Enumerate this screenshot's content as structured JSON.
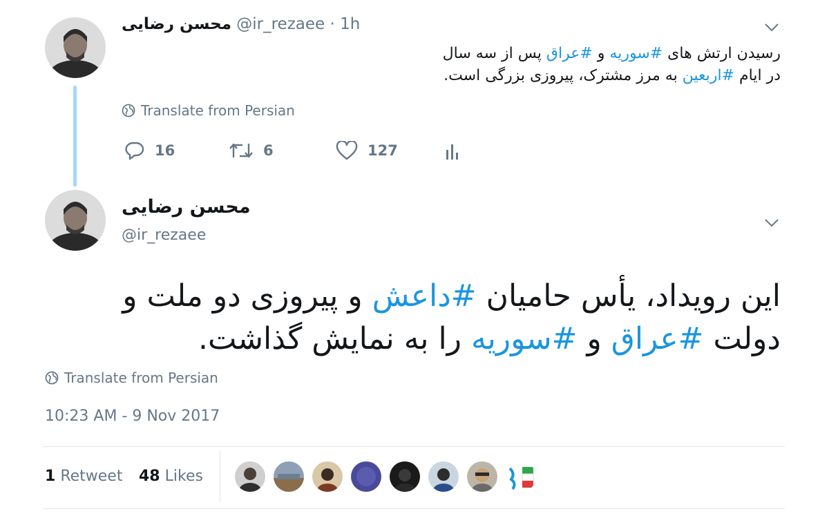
{
  "reply_tweet": {
    "author_name": "محسن رضایی",
    "handle": "@ir_rezaee",
    "separator": "·",
    "time": "1h",
    "text_parts": [
      {
        "t": "رسیدن ارتش های ",
        "tag": false
      },
      {
        "t": "#سوریه",
        "tag": true
      },
      {
        "t": " و ",
        "tag": false
      },
      {
        "t": "#عراق",
        "tag": true
      },
      {
        "t": " پس از سه سال در ایام ",
        "tag": false
      },
      {
        "t": "#اربعین",
        "tag": true
      },
      {
        "t": " به مرز مشترک، پیروزی بزرگی است.",
        "tag": false
      }
    ],
    "translate_label": "Translate from Persian",
    "reply_count": "16",
    "retweet_count": "6",
    "like_count": "127"
  },
  "main_tweet": {
    "author_name": "محسن رضایی",
    "handle": "@ir_rezaee",
    "text_parts": [
      {
        "t": "این رویداد، یأس حامیان ",
        "tag": false
      },
      {
        "t": "#داعش",
        "tag": true
      },
      {
        "t": " و پیروزی دو ملت و دولت ",
        "tag": false
      },
      {
        "t": "#عراق",
        "tag": true
      },
      {
        "t": " و ",
        "tag": false
      },
      {
        "t": "#سوریه",
        "tag": true
      },
      {
        "t": " را به نمایش گذاشت.",
        "tag": false
      }
    ],
    "translate_label": "Translate from Persian",
    "timestamp": "10:23 AM - 9 Nov 2017",
    "retweet_count": "1",
    "retweet_label": "Retweet",
    "like_count": "48",
    "like_label": "Likes"
  },
  "colors": {
    "accent": "#1b95e0",
    "thread_line": "#a5d6f7",
    "muted": "#657786",
    "text": "#14171a",
    "divider": "#e1e8ed"
  },
  "icons": {
    "caret": "chevron-down-icon",
    "globe": "globe-icon",
    "reply": "reply-icon",
    "retweet": "retweet-icon",
    "like": "heart-icon",
    "analytics": "analytics-icon"
  }
}
